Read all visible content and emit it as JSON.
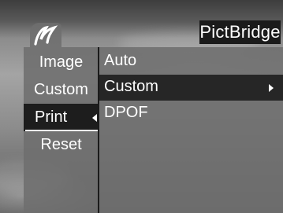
{
  "header": {
    "mode_title": "PictBridge",
    "brand_icon": "olympus-logo-icon"
  },
  "left_menu": {
    "items": [
      {
        "label": "Image",
        "selected": false
      },
      {
        "label": "Custom",
        "selected": false
      },
      {
        "label": "Print",
        "selected": true
      },
      {
        "label": "Reset",
        "selected": false
      }
    ]
  },
  "right_menu": {
    "items": [
      {
        "label": "Auto",
        "selected": false,
        "has_submenu": false
      },
      {
        "label": "Custom",
        "selected": true,
        "has_submenu": true
      },
      {
        "label": "DPOF",
        "selected": false,
        "has_submenu": false
      }
    ]
  },
  "colors": {
    "panel": "#6e6e6e",
    "selected_bg": "#1d1d1d",
    "highlight_bg": "#262626",
    "text": "#ffffff"
  }
}
